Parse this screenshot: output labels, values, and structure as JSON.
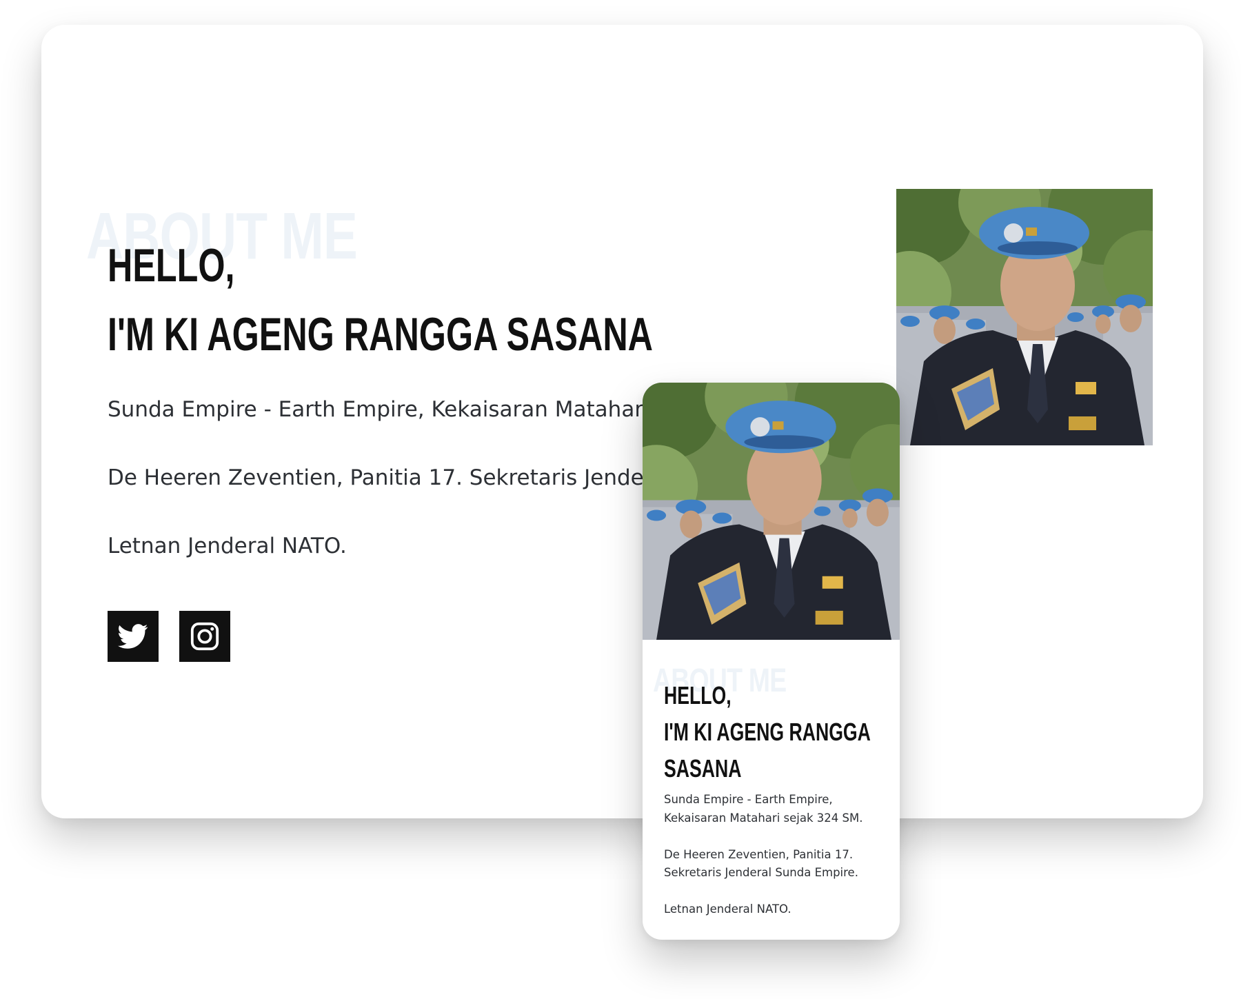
{
  "about_watermark": "ABOUT ME",
  "greeting": "HELLO,",
  "name_line": "I'M KI AGENG RANGGA SASANA",
  "name_line_wrapped": [
    "I'M KI AGENG RANGGA",
    "SASANA"
  ],
  "bio": [
    "Sunda Empire - Earth Empire, Kekaisaran Matahari sejak 324 SM.",
    "De Heeren Zeventien, Panitia 17. Sekretaris Jenderal Sunda Empire.",
    "Letnan Jenderal NATO."
  ],
  "social": [
    {
      "name": "twitter",
      "icon": "twitter-icon"
    },
    {
      "name": "instagram",
      "icon": "instagram-icon"
    }
  ],
  "colors": {
    "heading": "#111111",
    "text": "#2d3035",
    "watermark": "#eef3f8",
    "social_bg": "#111111",
    "beret_blue": "#4a88c7"
  },
  "photo": {
    "icon": "portrait-photo"
  }
}
